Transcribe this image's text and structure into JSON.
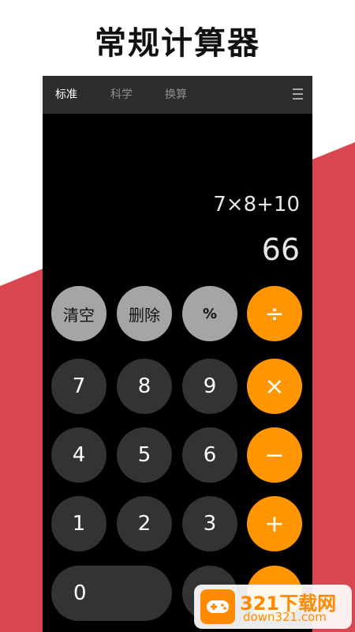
{
  "headline": "常规计算器",
  "tabs": [
    {
      "label": "标准",
      "active": true
    },
    {
      "label": "科学",
      "active": false
    },
    {
      "label": "换算",
      "active": false
    }
  ],
  "display": {
    "expression": "7×8+10",
    "result": "66"
  },
  "keys": {
    "clear": "清空",
    "delete": "删除",
    "percent": "%",
    "divide": "÷",
    "seven": "7",
    "eight": "8",
    "nine": "9",
    "multiply": "×",
    "four": "4",
    "five": "5",
    "six": "6",
    "minus": "−",
    "one": "1",
    "two": "2",
    "three": "3",
    "plus": "+",
    "zero": "0"
  },
  "watermark": {
    "brand": "321下载网",
    "domain": "down321.com"
  },
  "colors": {
    "accent_red": "#d8474f",
    "operator_orange": "#ff9500",
    "function_gray": "#a5a5a5",
    "digit_dark": "#333333",
    "screen_black": "#000000"
  }
}
